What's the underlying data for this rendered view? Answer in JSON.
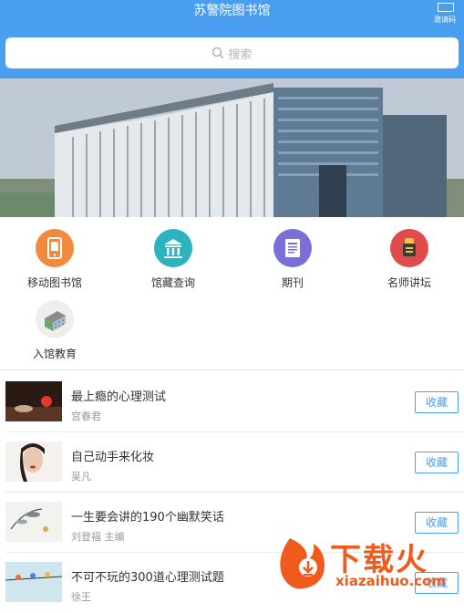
{
  "header": {
    "title": "苏警院图书馆",
    "scan_label": "邀请码"
  },
  "search": {
    "placeholder": "搜索"
  },
  "banner": {
    "dots": 4,
    "active_dot": 3
  },
  "menu": [
    {
      "label": "移动图书馆",
      "icon": "mobile-library-icon",
      "color": "#f08a3c"
    },
    {
      "label": "馆藏查询",
      "icon": "library-building-icon",
      "color": "#2bb3c0"
    },
    {
      "label": "期刊",
      "icon": "journal-icon",
      "color": "#7a6fd8"
    },
    {
      "label": "名师讲坛",
      "icon": "lecture-icon",
      "color": "#e04b4b"
    },
    {
      "label": "入馆教育",
      "icon": "building-icon",
      "color": "#e8e8e8"
    }
  ],
  "books": [
    {
      "title": "最上瘾的心理测试",
      "author": "宫春君",
      "button": "收藏"
    },
    {
      "title": "自己动手来化妆",
      "author": "吴凡",
      "button": "收藏"
    },
    {
      "title": "一生要会讲的190个幽默笑话",
      "author": "刘登福 主编",
      "button": "收藏"
    },
    {
      "title": "不可不玩的300道心理测试题",
      "author": "徐王",
      "button": "收藏"
    }
  ],
  "watermark": {
    "brand": "下载火",
    "url": "xiazaihuo.com"
  }
}
